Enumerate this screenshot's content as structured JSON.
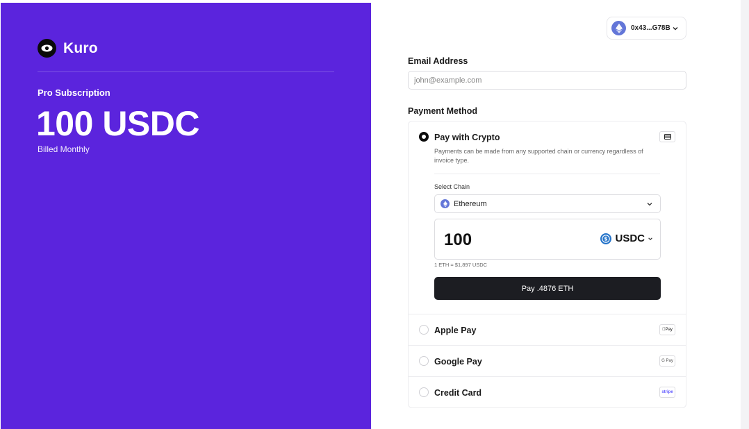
{
  "brand": {
    "name": "Kuro"
  },
  "plan": {
    "name": "Pro Subscription",
    "price": "100 USDC",
    "billing": "Billed Monthly"
  },
  "wallet": {
    "address": "0x43...G78B",
    "icon": "ethereum-icon"
  },
  "email": {
    "label": "Email Address",
    "placeholder": "john@example.com",
    "value": ""
  },
  "payment": {
    "label": "Payment Method",
    "crypto": {
      "title": "Pay with Crypto",
      "selected": true,
      "description": "Payments can be made from any supported chain or currency regardless of invoice type.",
      "chain_label": "Select Chain",
      "chain_value": "Ethereum",
      "amount": "100",
      "currency": "USDC",
      "rate": "1 ETH = $1,897 USDC",
      "pay_button": "Pay .4876 ETH"
    },
    "options": [
      {
        "title": "Apple Pay",
        "badge": "Pay"
      },
      {
        "title": "Google Pay",
        "badge": "G Pay"
      },
      {
        "title": "Credit Card",
        "badge": "stripe"
      }
    ]
  },
  "colors": {
    "brand_bg": "#5b24dd",
    "button_bg": "#1c1d22",
    "eth": "#6376d8",
    "usdc": "#2775ca"
  }
}
